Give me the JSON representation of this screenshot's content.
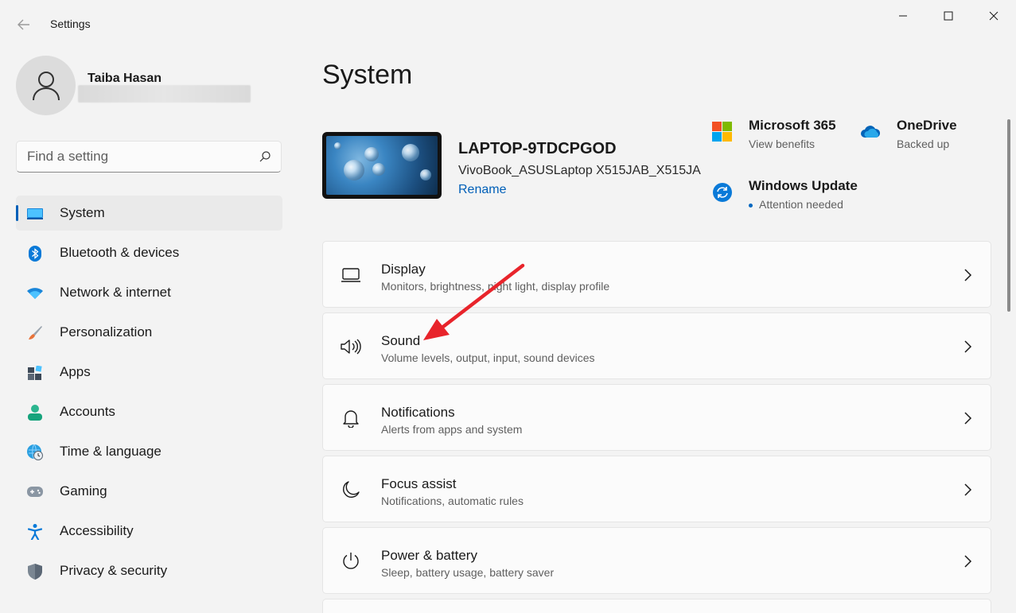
{
  "window": {
    "title": "Settings",
    "back_icon": "back-arrow-icon",
    "controls": [
      "minimize-icon",
      "maximize-icon",
      "close-icon"
    ]
  },
  "profile": {
    "name": "Taiba Hasan",
    "avatar_icon": "person-icon"
  },
  "search": {
    "placeholder": "Find a setting",
    "value": "",
    "icon": "search-icon"
  },
  "sidebar": {
    "items": [
      {
        "label": "System",
        "icon": "system-icon",
        "active": true
      },
      {
        "label": "Bluetooth & devices",
        "icon": "bluetooth-icon"
      },
      {
        "label": "Network & internet",
        "icon": "wifi-icon"
      },
      {
        "label": "Personalization",
        "icon": "brush-icon"
      },
      {
        "label": "Apps",
        "icon": "apps-icon"
      },
      {
        "label": "Accounts",
        "icon": "accounts-icon"
      },
      {
        "label": "Time & language",
        "icon": "globe-clock-icon"
      },
      {
        "label": "Gaming",
        "icon": "gamepad-icon"
      },
      {
        "label": "Accessibility",
        "icon": "accessibility-icon"
      },
      {
        "label": "Privacy & security",
        "icon": "shield-icon"
      }
    ]
  },
  "main": {
    "title": "System",
    "device": {
      "name": "LAPTOP-9TDCPGOD",
      "model": "VivoBook_ASUSLaptop X515JAB_X515JA",
      "rename_label": "Rename"
    },
    "quick_links": [
      {
        "title": "Microsoft 365",
        "subtitle": "View benefits",
        "icon": "microsoft-logo-icon"
      },
      {
        "title": "OneDrive",
        "subtitle": "Backed up",
        "icon": "onedrive-cloud-icon"
      },
      {
        "title": "Windows Update",
        "subtitle": "Attention needed",
        "icon": "windows-update-icon"
      }
    ],
    "cards": [
      {
        "title": "Display",
        "subtitle": "Monitors, brightness, night light, display profile",
        "icon": "display-icon"
      },
      {
        "title": "Sound",
        "subtitle": "Volume levels, output, input, sound devices",
        "icon": "speaker-icon"
      },
      {
        "title": "Notifications",
        "subtitle": "Alerts from apps and system",
        "icon": "bell-icon"
      },
      {
        "title": "Focus assist",
        "subtitle": "Notifications, automatic rules",
        "icon": "moon-icon"
      },
      {
        "title": "Power & battery",
        "subtitle": "Sleep, battery usage, battery saver",
        "icon": "power-icon"
      }
    ]
  },
  "colors": {
    "accent": "#005fb8",
    "background": "#f3f3f3",
    "card": "#fbfbfb",
    "annotation_arrow": "#e8242b",
    "update_dot": "#0067c0"
  }
}
